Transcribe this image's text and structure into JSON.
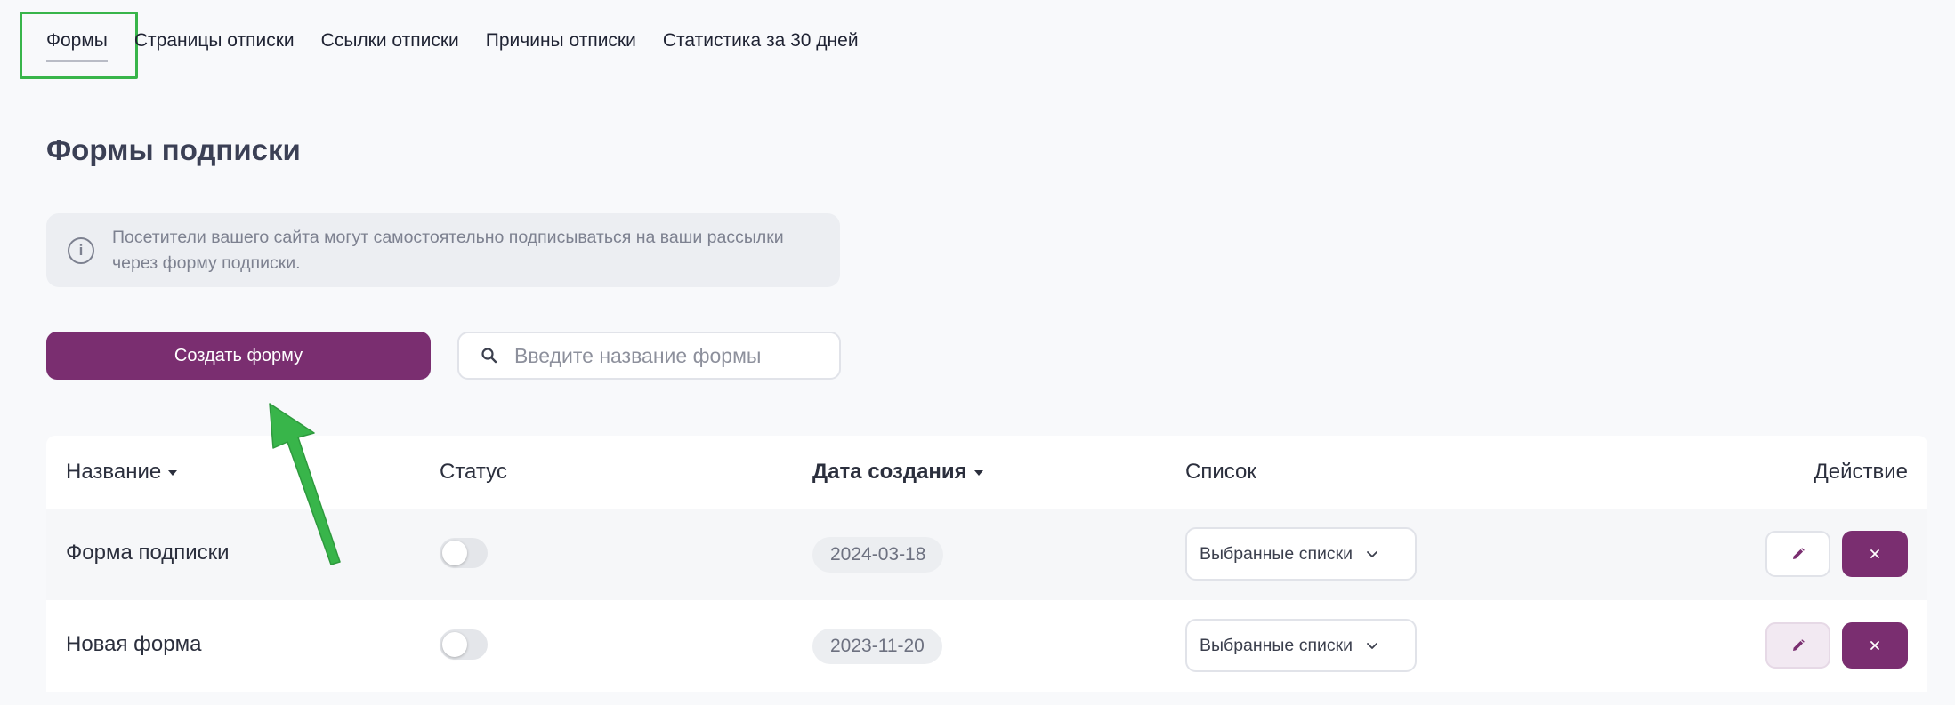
{
  "tabs": [
    {
      "label": "Формы",
      "active": true
    },
    {
      "label": "Страницы отписки",
      "active": false
    },
    {
      "label": "Ссылки отписки",
      "active": false
    },
    {
      "label": "Причины отписки",
      "active": false
    },
    {
      "label": "Статистика за 30 дней",
      "active": false
    }
  ],
  "page": {
    "title": "Формы подписки",
    "info_icon": "info-icon",
    "info_text": "Посетители вашего сайта могут самостоятельно подписываться на ваши рассылки через форму подписки."
  },
  "actions": {
    "create_label": "Создать форму",
    "search_placeholder": "Введите название формы",
    "search_value": "",
    "search_icon": "search-icon"
  },
  "table": {
    "headers": {
      "name": "Название",
      "status": "Статус",
      "created": "Дата создания",
      "list": "Список",
      "action": "Действие"
    },
    "rows": [
      {
        "name": "Форма подписки",
        "status_on": false,
        "created": "2024-03-18",
        "list": "Выбранные списки"
      },
      {
        "name": "Новая форма",
        "status_on": false,
        "created": "2023-11-20",
        "list": "Выбранные списки"
      }
    ]
  },
  "colors": {
    "brand": "#7a2e70",
    "annotation": "#38b54a",
    "background": "#f8f9fb"
  }
}
